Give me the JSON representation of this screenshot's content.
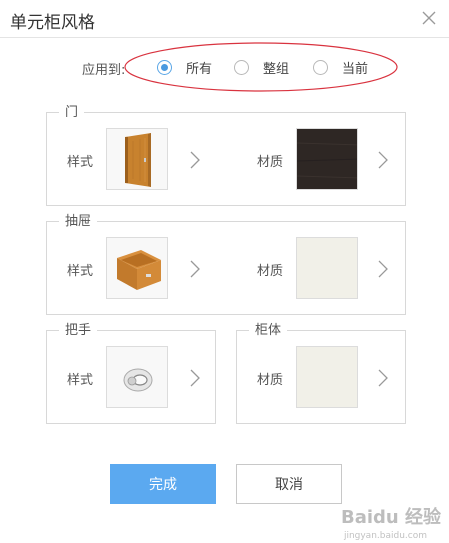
{
  "dialog": {
    "title": "单元柜风格"
  },
  "apply_to": {
    "label": "应用到:",
    "options": [
      {
        "label": "所有",
        "checked": true
      },
      {
        "label": "整组",
        "checked": false
      },
      {
        "label": "当前",
        "checked": false
      }
    ]
  },
  "sections": {
    "door": {
      "title": "门",
      "style_label": "样式",
      "material_label": "材质"
    },
    "drawer": {
      "title": "抽屉",
      "style_label": "样式",
      "material_label": "材质"
    },
    "handle": {
      "title": "把手",
      "style_label": "样式"
    },
    "cabinet": {
      "title": "柜体",
      "material_label": "材质"
    }
  },
  "buttons": {
    "ok": "完成",
    "cancel": "取消"
  },
  "watermark": {
    "text": "Baidu 经验",
    "sub": "jingyan.baidu.com"
  },
  "colors": {
    "accent": "#5ba9f0",
    "wood": "#c8822e",
    "dark_material": "#2e2724",
    "light_material": "#f1f0e8",
    "annotation": "#d9333f"
  }
}
